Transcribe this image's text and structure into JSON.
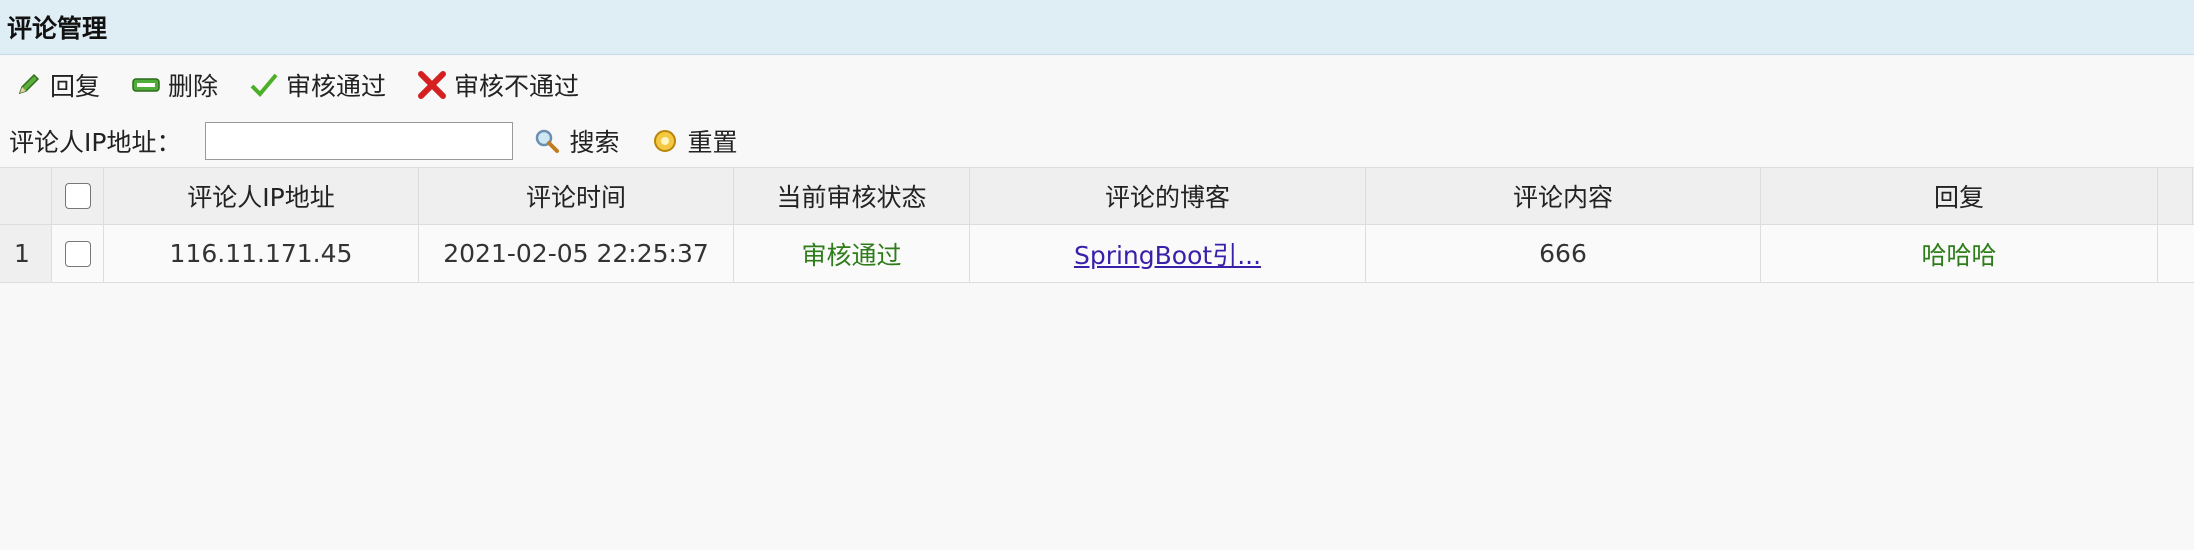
{
  "panel": {
    "title": "评论管理"
  },
  "toolbar": {
    "reply_label": "回复",
    "delete_label": "删除",
    "approve_label": "审核通过",
    "reject_label": "审核不通过"
  },
  "search": {
    "label": "评论人IP地址：",
    "value": "",
    "placeholder": "",
    "search_label": "搜索",
    "reset_label": "重置"
  },
  "table": {
    "headers": {
      "ip": "评论人IP地址",
      "time": "评论时间",
      "status": "当前审核状态",
      "blog": "评论的博客",
      "content": "评论内容",
      "reply": "回复"
    },
    "rows": [
      {
        "num": "1",
        "ip": "116.11.171.45",
        "time": "2021-02-05 22:25:37",
        "status": "审核通过",
        "blog": "SpringBoot引...",
        "content": "666",
        "reply": "哈哈哈"
      }
    ]
  },
  "colors": {
    "header_bg": "#dfeef5",
    "status_green": "#2e7d1a",
    "link": "#3a1fa8"
  },
  "icons": {
    "reply": "pencil-icon",
    "delete": "minus-bar-icon",
    "approve": "checkmark-icon",
    "reject": "cross-icon",
    "search": "magnifier-icon",
    "reset": "reload-icon"
  }
}
